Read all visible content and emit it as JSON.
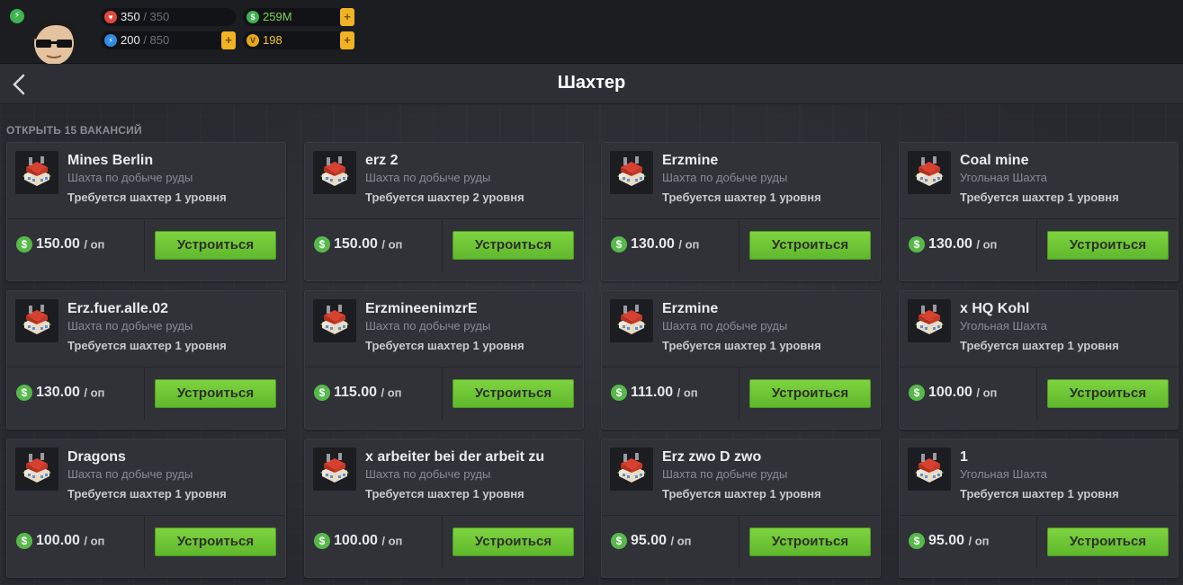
{
  "status": {
    "health_value": "350",
    "health_max": "/ 350",
    "energy_value": "200",
    "energy_max": "/ 850",
    "cash": "259M",
    "vip": "198"
  },
  "header": {
    "title": "Шахтер"
  },
  "vacancies_label": "ОТКРЫТЬ 15 ВАКАНСИЙ",
  "apply_label": "Устроиться",
  "unit_label": "/ оп",
  "jobs": [
    {
      "name": "Mines Berlin",
      "type": "Шахта по добыче руды",
      "req": "Требуется шахтер 1 уровня",
      "pay": "150.00"
    },
    {
      "name": "erz 2",
      "type": "Шахта по добыче руды",
      "req": "Требуется шахтер 2 уровня",
      "pay": "150.00"
    },
    {
      "name": "Erzmine",
      "type": "Шахта по добыче руды",
      "req": "Требуется шахтер 1 уровня",
      "pay": "130.00"
    },
    {
      "name": "Coal mine",
      "type": "Угольная Шахта",
      "req": "Требуется шахтер 1 уровня",
      "pay": "130.00"
    },
    {
      "name": "Erz.fuer.alle.02",
      "type": "Шахта по добыче руды",
      "req": "Требуется шахтер 1 уровня",
      "pay": "130.00"
    },
    {
      "name": "ErzmineenimzrE",
      "type": "Шахта по добыче руды",
      "req": "Требуется шахтер 1 уровня",
      "pay": "115.00"
    },
    {
      "name": "Erzmine",
      "type": "Шахта по добыче руды",
      "req": "Требуется шахтер 1 уровня",
      "pay": "111.00"
    },
    {
      "name": "x HQ Kohl",
      "type": "Угольная Шахта",
      "req": "Требуется шахтер 1 уровня",
      "pay": "100.00"
    },
    {
      "name": "Dragons",
      "type": "Шахта по добыче руды",
      "req": "Требуется шахтер 1 уровня",
      "pay": "100.00"
    },
    {
      "name": "x arbeiter bei der arbeit zu",
      "type": "Шахта по добыче руды",
      "req": "Требуется шахтер 1 уровня",
      "pay": "100.00"
    },
    {
      "name": "Erz zwo D zwo",
      "type": "Шахта по добыче руды",
      "req": "Требуется шахтер 1 уровня",
      "pay": "95.00"
    },
    {
      "name": "1",
      "type": "Угольная Шахта",
      "req": "Требуется шахтер 1 уровня",
      "pay": "95.00"
    }
  ],
  "icons": {
    "energy": "lightning-icon",
    "health": "heart-icon",
    "cash": "dollar-icon",
    "vip": "vip-icon",
    "back": "chevron-left-icon",
    "job_logo": "mine-building-icon"
  },
  "colors": {
    "accent_green": "#6cc637",
    "plus_gold": "#f0b323",
    "cash_green": "#56b94a"
  }
}
